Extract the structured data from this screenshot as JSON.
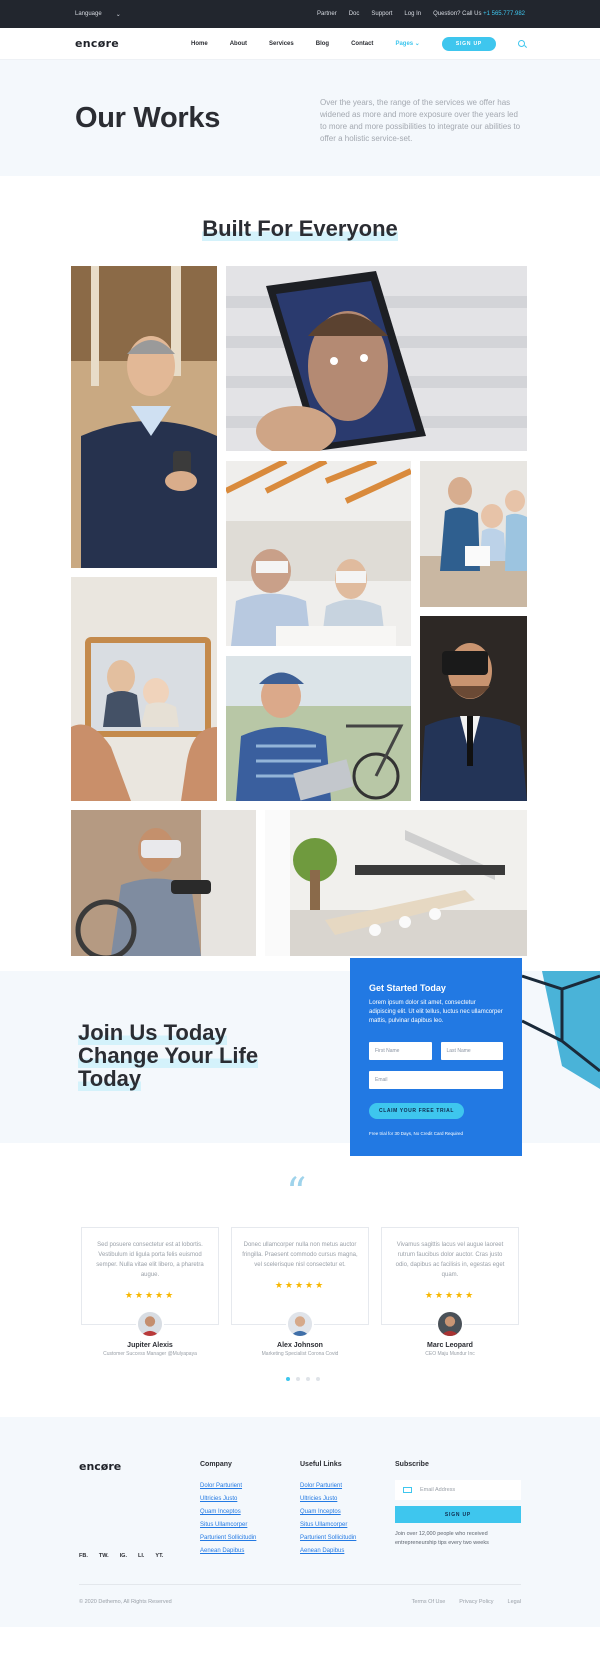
{
  "topbar": {
    "language": "Language",
    "links": [
      "Partner",
      "Doc",
      "Support",
      "Log In"
    ],
    "question": "Question? Call Us",
    "phone": "+1 565.777.982"
  },
  "header": {
    "logo": "encøre",
    "nav": [
      "Home",
      "About",
      "Services",
      "Blog",
      "Contact"
    ],
    "pages": "Pages",
    "signup": "SIGN UP"
  },
  "hero": {
    "title": "Our Works",
    "text": "Over the years, the range of the services we offer has widened as more and more exposure over the years led to more and more possibilities to integrate our abilities to offer a holistic service-set."
  },
  "works": {
    "title": "Built For Everyone"
  },
  "join": {
    "line1": "Join Us Today",
    "line2": "Change Your Life",
    "line3": "Today",
    "form_title": "Get Started Today",
    "form_text": "Lorem ipsum dolor sit amet, consectetur adipiscing elit. Ut elit tellus, luctus nec ullamcorper mattis, pulvinar dapibus leo.",
    "first_name": "First Name",
    "last_name": "Last Name",
    "email": "Email",
    "claim": "CLAIM YOUR FREE TRIAL",
    "note": "Free trial for 30 Days, No Credit Card Required"
  },
  "testimonials": {
    "quote_mark": "“",
    "items": [
      {
        "text": "Sed posuere consectetur est at lobortis. Vestibulum id ligula porta felis euismod semper. Nulla vitae elit libero, a pharetra augue.",
        "stars": "★★★★★",
        "name": "Jupiter Alexis",
        "role": "Customer Success Manager @Mulyapaya"
      },
      {
        "text": "Donec ullamcorper nulla non metus auctor fringilla. Praesent commodo cursus magna, vel scelerisque nisl consectetur et.",
        "stars": "★★★★★",
        "name": "Alex Johnson",
        "role": "Marketing Specialist Corona Covid"
      },
      {
        "text": "Vivamus sagittis lacus vel augue laoreet rutrum faucibus dolor auctor. Cras justo odio, dapibus ac facilisis in, egestas eget quam.",
        "stars": "★★★★★",
        "name": "Marc Leopard",
        "role": "CEO Maju Mundur Inc"
      }
    ]
  },
  "footer": {
    "logo": "encøre",
    "social": [
      "FB.",
      "TW.",
      "IG.",
      "LI.",
      "YT."
    ],
    "company_title": "Company",
    "company_links": [
      "Dolor Parturient",
      "Ultricies Justo",
      "Quam Inceptos",
      "Situs Ullamcorper",
      "Parturient Sollicitudin",
      "Aenean Dapibus"
    ],
    "useful_title": "Useful Links",
    "useful_links": [
      "Dolor Parturient",
      "Ultricies Justo",
      "Quam Inceptos",
      "Situs Ullamcorper",
      "Parturient Sollicitudin",
      "Aenean Dapibus"
    ],
    "subscribe_title": "Subscribe",
    "email_placeholder": "Email Address",
    "signup": "SIGN UP",
    "subscribe_text": "Join over 12,000 people who received entrepreneurship tips every two weeks",
    "copyright": "© 2020 Dethemo, All Rights Reserved",
    "legal": [
      "Terms Of Use",
      "Privacy Policy",
      "Legal"
    ]
  },
  "colors": {
    "accent": "#3ec6ee",
    "blue": "#2279e3",
    "dark": "#22262e",
    "light_bg": "#f4f8fc"
  }
}
